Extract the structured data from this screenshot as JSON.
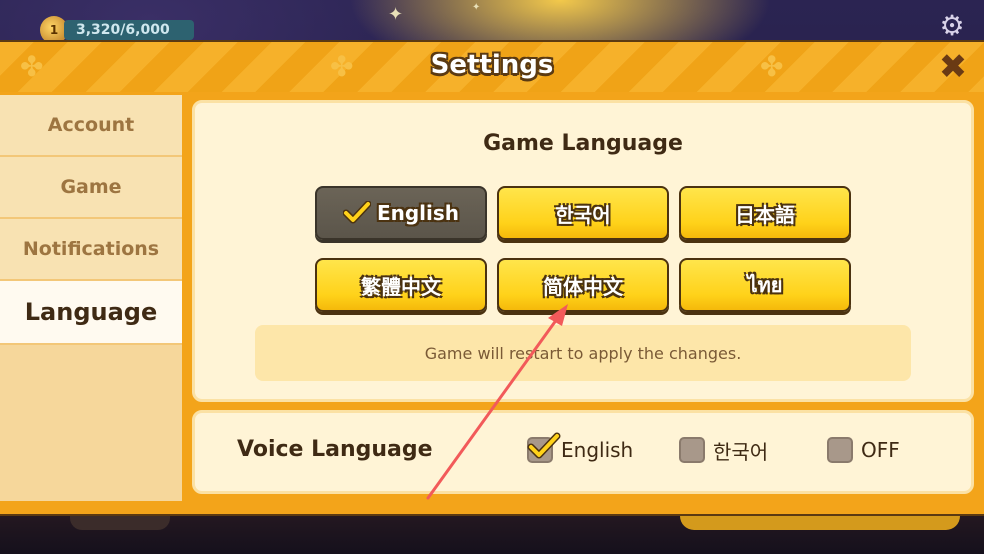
{
  "hud": {
    "level": "1",
    "progress_text": "3,320/6,000"
  },
  "panel": {
    "title": "Settings"
  },
  "sidebar": {
    "tabs": [
      {
        "label": "Account",
        "active": false
      },
      {
        "label": "Game",
        "active": false
      },
      {
        "label": "Notifications",
        "active": false
      },
      {
        "label": "Language",
        "active": true
      }
    ]
  },
  "game_language": {
    "title": "Game Language",
    "options": [
      {
        "label": "English",
        "selected": true
      },
      {
        "label": "한국어",
        "selected": false
      },
      {
        "label": "日本語",
        "selected": false
      },
      {
        "label": "繁體中文",
        "selected": false
      },
      {
        "label": "简体中文",
        "selected": false
      },
      {
        "label": "ไทย",
        "selected": false
      }
    ],
    "notice": "Game will restart to apply the changes."
  },
  "voice_language": {
    "title": "Voice Language",
    "options": [
      {
        "label": "English",
        "checked": true
      },
      {
        "label": "한국어",
        "checked": false
      },
      {
        "label": "OFF",
        "checked": false
      }
    ]
  },
  "colors": {
    "panel_orange": "#f3a41a",
    "button_yellow": "#ffd21a",
    "selected_gray": "#5b554a",
    "annotation_arrow": "#f25a5a"
  },
  "icons": {
    "close": "close-icon",
    "settings": "gear-icon",
    "check": "check-icon"
  }
}
